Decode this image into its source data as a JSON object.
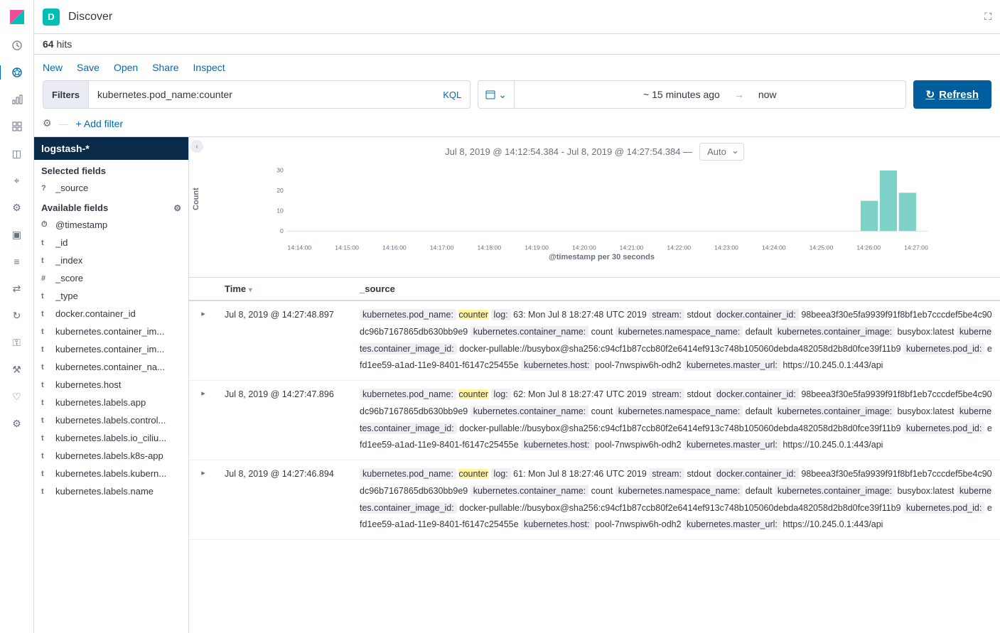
{
  "page_title": "Discover",
  "app_badge_letter": "D",
  "hits": {
    "count": "64",
    "label": "hits"
  },
  "actions": {
    "new": "New",
    "save": "Save",
    "open": "Open",
    "share": "Share",
    "inspect": "Inspect"
  },
  "query": {
    "filters_label": "Filters",
    "value": "kubernetes.pod_name:counter",
    "kql_label": "KQL"
  },
  "datepicker": {
    "from": "~ 15 minutes ago",
    "to": "now"
  },
  "refresh_label": "Refresh",
  "add_filter_label": "+ Add filter",
  "index_pattern": "logstash-*",
  "selected_fields_header": "Selected fields",
  "available_fields_header": "Available fields",
  "selected_fields": [
    {
      "type": "?",
      "name": "_source"
    }
  ],
  "available_fields": [
    {
      "type": "⏱",
      "name": "@timestamp"
    },
    {
      "type": "t",
      "name": "_id"
    },
    {
      "type": "t",
      "name": "_index"
    },
    {
      "type": "#",
      "name": "_score"
    },
    {
      "type": "t",
      "name": "_type"
    },
    {
      "type": "t",
      "name": "docker.container_id"
    },
    {
      "type": "t",
      "name": "kubernetes.container_im..."
    },
    {
      "type": "t",
      "name": "kubernetes.container_im..."
    },
    {
      "type": "t",
      "name": "kubernetes.container_na..."
    },
    {
      "type": "t",
      "name": "kubernetes.host"
    },
    {
      "type": "t",
      "name": "kubernetes.labels.app"
    },
    {
      "type": "t",
      "name": "kubernetes.labels.control..."
    },
    {
      "type": "t",
      "name": "kubernetes.labels.io_ciliu..."
    },
    {
      "type": "t",
      "name": "kubernetes.labels.k8s-app"
    },
    {
      "type": "t",
      "name": "kubernetes.labels.kubern..."
    },
    {
      "type": "t",
      "name": "kubernetes.labels.name"
    }
  ],
  "chart_title_range": "Jul 8, 2019 @ 14:12:54.384 - Jul 8, 2019 @ 14:27:54.384 —",
  "chart_interval": "Auto",
  "chart_data": {
    "type": "bar",
    "ylabel": "Count",
    "xlabel": "@timestamp per 30 seconds",
    "ylim": [
      0,
      32
    ],
    "yticks": [
      0,
      10,
      20,
      30
    ],
    "xticks": [
      "14:14:00",
      "14:15:00",
      "14:16:00",
      "14:17:00",
      "14:18:00",
      "14:19:00",
      "14:20:00",
      "14:21:00",
      "14:22:00",
      "14:23:00",
      "14:24:00",
      "14:25:00",
      "14:26:00",
      "14:27:00"
    ],
    "series": [
      {
        "x": "14:26:30",
        "value": 15
      },
      {
        "x": "14:27:00",
        "value": 30
      },
      {
        "x": "14:27:30",
        "value": 19
      }
    ]
  },
  "table": {
    "time_header": "Time",
    "source_header": "_source",
    "rows": [
      {
        "time": "Jul 8, 2019 @ 14:27:48.897",
        "fields": [
          {
            "k": "kubernetes.pod_name:",
            "v": "counter",
            "hl": true
          },
          {
            "k": "log:",
            "v": "63: Mon Jul 8 18:27:48 UTC 2019"
          },
          {
            "k": "stream:",
            "v": "stdout"
          },
          {
            "k": "docker.container_id:",
            "v": "98beea3f30e5fa9939f91f8bf1eb7cccdef5be4c90dc96b7167865db630bb9e9"
          },
          {
            "k": "kubernetes.container_name:",
            "v": "count"
          },
          {
            "k": "kubernetes.namespace_name:",
            "v": "default"
          },
          {
            "k": "kubernetes.container_image:",
            "v": "busybox:latest"
          },
          {
            "k": "kubernetes.container_image_id:",
            "v": "docker-pullable://busybox@sha256:c94cf1b87ccb80f2e6414ef913c748b105060debda482058d2b8d0fce39f11b9"
          },
          {
            "k": "kubernetes.pod_id:",
            "v": "efd1ee59-a1ad-11e9-8401-f6147c25455e"
          },
          {
            "k": "kubernetes.host:",
            "v": "pool-7nwspiw6h-odh2"
          },
          {
            "k": "kubernetes.master_url:",
            "v": "https://10.245.0.1:443/api"
          }
        ]
      },
      {
        "time": "Jul 8, 2019 @ 14:27:47.896",
        "fields": [
          {
            "k": "kubernetes.pod_name:",
            "v": "counter",
            "hl": true
          },
          {
            "k": "log:",
            "v": "62: Mon Jul 8 18:27:47 UTC 2019"
          },
          {
            "k": "stream:",
            "v": "stdout"
          },
          {
            "k": "docker.container_id:",
            "v": "98beea3f30e5fa9939f91f8bf1eb7cccdef5be4c90dc96b7167865db630bb9e9"
          },
          {
            "k": "kubernetes.container_name:",
            "v": "count"
          },
          {
            "k": "kubernetes.namespace_name:",
            "v": "default"
          },
          {
            "k": "kubernetes.container_image:",
            "v": "busybox:latest"
          },
          {
            "k": "kubernetes.container_image_id:",
            "v": "docker-pullable://busybox@sha256:c94cf1b87ccb80f2e6414ef913c748b105060debda482058d2b8d0fce39f11b9"
          },
          {
            "k": "kubernetes.pod_id:",
            "v": "efd1ee59-a1ad-11e9-8401-f6147c25455e"
          },
          {
            "k": "kubernetes.host:",
            "v": "pool-7nwspiw6h-odh2"
          },
          {
            "k": "kubernetes.master_url:",
            "v": "https://10.245.0.1:443/api"
          }
        ]
      },
      {
        "time": "Jul 8, 2019 @ 14:27:46.894",
        "fields": [
          {
            "k": "kubernetes.pod_name:",
            "v": "counter",
            "hl": true
          },
          {
            "k": "log:",
            "v": "61: Mon Jul 8 18:27:46 UTC 2019"
          },
          {
            "k": "stream:",
            "v": "stdout"
          },
          {
            "k": "docker.container_id:",
            "v": "98beea3f30e5fa9939f91f8bf1eb7cccdef5be4c90dc96b7167865db630bb9e9"
          },
          {
            "k": "kubernetes.container_name:",
            "v": "count"
          },
          {
            "k": "kubernetes.namespace_name:",
            "v": "default"
          },
          {
            "k": "kubernetes.container_image:",
            "v": "busybox:latest"
          },
          {
            "k": "kubernetes.container_image_id:",
            "v": "docker-pullable://busybox@sha256:c94cf1b87ccb80f2e6414ef913c748b105060debda482058d2b8d0fce39f11b9"
          },
          {
            "k": "kubernetes.pod_id:",
            "v": "efd1ee59-a1ad-11e9-8401-f6147c25455e"
          },
          {
            "k": "kubernetes.host:",
            "v": "pool-7nwspiw6h-odh2"
          },
          {
            "k": "kubernetes.master_url:",
            "v": "https://10.245.0.1:443/api"
          }
        ]
      }
    ]
  }
}
